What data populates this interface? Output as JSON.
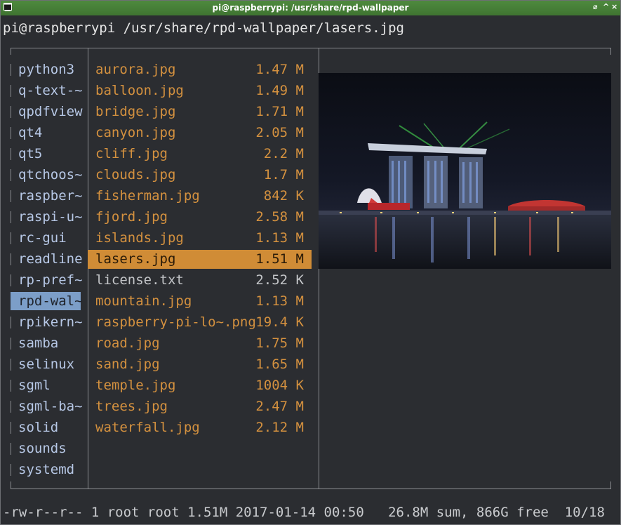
{
  "window": {
    "title": "pi@raspberrypi: /usr/share/rpd-wallpaper",
    "controls": [
      "⌀",
      "^",
      "×"
    ]
  },
  "terminal": {
    "path": "pi@raspberrypi /usr/share/rpd-wallpaper/lasers.jpg"
  },
  "left_column": {
    "items": [
      {
        "label": "python3"
      },
      {
        "label": "q-text-~"
      },
      {
        "label": "qpdfview"
      },
      {
        "label": "qt4"
      },
      {
        "label": "qt5"
      },
      {
        "label": "qtchoos~"
      },
      {
        "label": "raspber~"
      },
      {
        "label": "raspi-u~"
      },
      {
        "label": "rc-gui"
      },
      {
        "label": "readline"
      },
      {
        "label": "rp-pref~"
      },
      {
        "label": "rpd-wal~",
        "selected": true
      },
      {
        "label": "rpikern~"
      },
      {
        "label": "samba"
      },
      {
        "label": "selinux"
      },
      {
        "label": "sgml"
      },
      {
        "label": "sgml-ba~"
      },
      {
        "label": "solid"
      },
      {
        "label": "sounds"
      },
      {
        "label": "systemd"
      }
    ]
  },
  "file_column": {
    "files": [
      {
        "name": "aurora.jpg",
        "size": "1.47 M"
      },
      {
        "name": "balloon.jpg",
        "size": "1.49 M"
      },
      {
        "name": "bridge.jpg",
        "size": "1.71 M"
      },
      {
        "name": "canyon.jpg",
        "size": "2.05 M"
      },
      {
        "name": "cliff.jpg",
        "size": "2.2 M"
      },
      {
        "name": "clouds.jpg",
        "size": "1.7 M"
      },
      {
        "name": "fisherman.jpg",
        "size": "842 K"
      },
      {
        "name": "fjord.jpg",
        "size": "2.58 M"
      },
      {
        "name": "islands.jpg",
        "size": "1.13 M"
      },
      {
        "name": "lasers.jpg",
        "size": "1.51 M",
        "selected": true
      },
      {
        "name": "license.txt",
        "size": "2.52 K",
        "text_file": true
      },
      {
        "name": "mountain.jpg",
        "size": "1.13 M"
      },
      {
        "name": "raspberry-pi-lo~.png",
        "size": "19.4 K"
      },
      {
        "name": "road.jpg",
        "size": "1.75 M"
      },
      {
        "name": "sand.jpg",
        "size": "1.65 M"
      },
      {
        "name": "temple.jpg",
        "size": "1004 K"
      },
      {
        "name": "trees.jpg",
        "size": "2.47 M"
      },
      {
        "name": "waterfall.jpg",
        "size": "2.12 M"
      }
    ]
  },
  "preview": {
    "subject": "lasers.jpg preview: Marina Bay Sands at night"
  },
  "status": {
    "text": "-rw-r--r-- 1 root root 1.51M 2017-01-14 00:50   26.8M sum, 866G free  10/18  All"
  },
  "colors": {
    "titlebar": "#4a8438",
    "background": "#2b2d31",
    "file_color": "#d4913f",
    "dir_color": "#b7c8e6",
    "selection_file": "#d08c36",
    "selection_dir": "#7c9ec8"
  }
}
